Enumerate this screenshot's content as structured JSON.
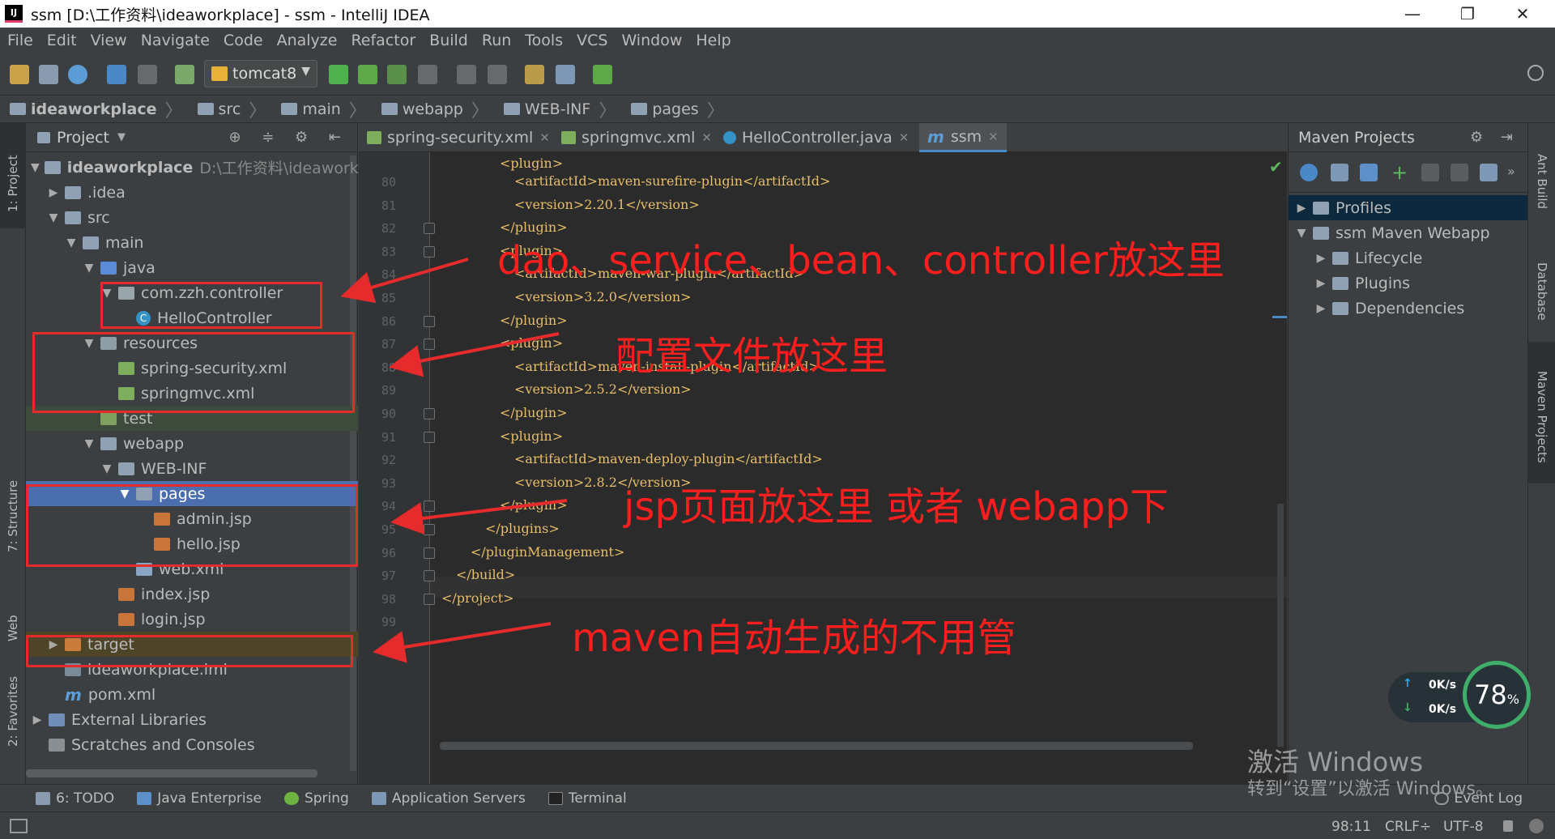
{
  "window": {
    "title": "ssm [D:\\工作资料\\ideaworkplace] - ssm - IntelliJ IDEA",
    "app_icon": "IJ",
    "minimize": "—",
    "restore": "❐",
    "close": "✕"
  },
  "menu": [
    "File",
    "Edit",
    "View",
    "Navigate",
    "Code",
    "Analyze",
    "Refactor",
    "Build",
    "Run",
    "Tools",
    "VCS",
    "Window",
    "Help"
  ],
  "toolbar": {
    "run_config": "tomcat8"
  },
  "breadcrumb": [
    "ideaworkplace",
    "src",
    "main",
    "webapp",
    "WEB-INF",
    "pages"
  ],
  "left_strip": {
    "project": "1: Project",
    "structure": "7: Structure",
    "web": "Web",
    "favorites": "2: Favorites"
  },
  "project_panel": {
    "title": "Project",
    "tree": [
      {
        "label": "ideaworkplace",
        "extra": "D:\\工作资料\\ideaworkplace"
      },
      {
        "label": ".idea"
      },
      {
        "label": "src"
      },
      {
        "label": "main"
      },
      {
        "label": "java"
      },
      {
        "label": "com.zzh.controller"
      },
      {
        "label": "HelloController"
      },
      {
        "label": "resources"
      },
      {
        "label": "spring-security.xml"
      },
      {
        "label": "springmvc.xml"
      },
      {
        "label": "test"
      },
      {
        "label": "webapp"
      },
      {
        "label": "WEB-INF"
      },
      {
        "label": "pages"
      },
      {
        "label": "admin.jsp"
      },
      {
        "label": "hello.jsp"
      },
      {
        "label": "web.xml"
      },
      {
        "label": "index.jsp"
      },
      {
        "label": "login.jsp"
      },
      {
        "label": "target"
      },
      {
        "label": "ideaworkplace.iml"
      },
      {
        "label": "pom.xml"
      },
      {
        "label": "External Libraries"
      },
      {
        "label": "Scratches and Consoles"
      }
    ]
  },
  "editor": {
    "tabs": [
      {
        "label": "spring-security.xml"
      },
      {
        "label": "springmvc.xml"
      },
      {
        "label": "HelloController.java"
      },
      {
        "label": "ssm"
      }
    ],
    "lines": [
      {
        "n": "80",
        "code": "<artifactId>maven-surefire-plugin</artifactId>"
      },
      {
        "n": "81",
        "code": "<version>2.20.1</version>"
      },
      {
        "n": "82",
        "code": "</plugin>"
      },
      {
        "n": "83",
        "code": "<plugin>"
      },
      {
        "n": "84",
        "code": "<artifactId>maven-war-plugin</artifactId>"
      },
      {
        "n": "85",
        "code": "<version>3.2.0</version>"
      },
      {
        "n": "86",
        "code": "</plugin>"
      },
      {
        "n": "87",
        "code": "<plugin>"
      },
      {
        "n": "88",
        "code": "<artifactId>maven-install-plugin</artifactId>"
      },
      {
        "n": "89",
        "code": "<version>2.5.2</version>"
      },
      {
        "n": "90",
        "code": "</plugin>"
      },
      {
        "n": "91",
        "code": "<plugin>"
      },
      {
        "n": "92",
        "code": "<artifactId>maven-deploy-plugin</artifactId>"
      },
      {
        "n": "93",
        "code": "<version>2.8.2</version>"
      },
      {
        "n": "94",
        "code": "</plugin>"
      },
      {
        "n": "95",
        "code": "</plugins>"
      },
      {
        "n": "96",
        "code": "</pluginManagement>"
      },
      {
        "n": "97",
        "code": "</build>"
      },
      {
        "n": "98",
        "code": "</project>"
      },
      {
        "n": "99",
        "code": ""
      }
    ],
    "top_partial": "<plugin>"
  },
  "maven": {
    "title": "Maven Projects",
    "tree": [
      {
        "label": "Profiles"
      },
      {
        "label": "ssm Maven Webapp"
      },
      {
        "label": "Lifecycle"
      },
      {
        "label": "Plugins"
      },
      {
        "label": "Dependencies"
      }
    ]
  },
  "right_strip": {
    "ant": "Ant Build",
    "database": "Database",
    "maven": "Maven Projects"
  },
  "bottom_tools": [
    {
      "label": "6: TODO"
    },
    {
      "label": "Java Enterprise"
    },
    {
      "label": "Spring"
    },
    {
      "label": "Application Servers"
    },
    {
      "label": "Terminal"
    }
  ],
  "event_log": "Event Log",
  "status": {
    "position": "98:11",
    "line_sep": "CRLF÷",
    "encoding": "UTF-8"
  },
  "widget": {
    "up": "0K/s",
    "down": "0K/s",
    "percent": "78",
    "percent_unit": "%"
  },
  "watermark": {
    "line1": "激活 Windows",
    "line2": "转到“设置”以激活 Windows。"
  },
  "annotations": {
    "a1": "dao、service、bean、controller放这里",
    "a2": "配置文件放这里",
    "a3": "jsp页面放这里 或者 webapp下",
    "a4": "maven自动生成的不用管"
  },
  "colors": {
    "annotation": "#e52b2b",
    "selection": "#4b6eaf",
    "accent": "#4a88c7"
  }
}
